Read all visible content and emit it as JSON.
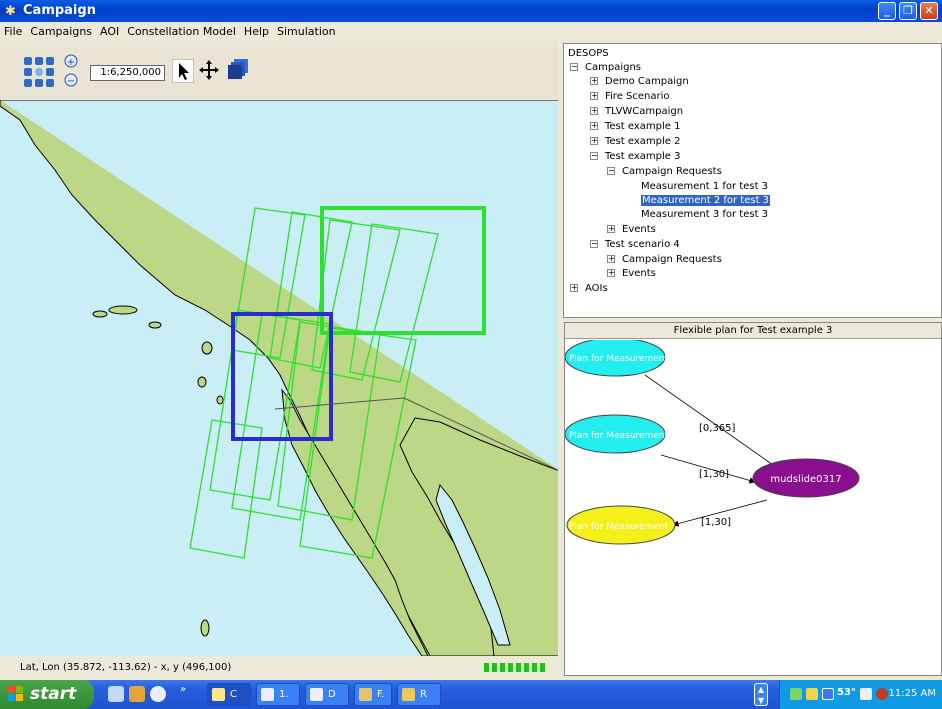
{
  "window": {
    "title": "Campaign"
  },
  "menu": [
    "File",
    "Campaigns",
    "AOI",
    "Constellation Model",
    "Help",
    "Simulation"
  ],
  "toolbar": {
    "scale": "1:6,250,000"
  },
  "status": {
    "coords": "Lat, Lon (35.872, -113.62) - x, y (496,100)"
  },
  "tree": {
    "root": "DESOPS",
    "campaigns": "Campaigns",
    "items": [
      "Demo Campaign",
      "Fire Scenario",
      "TLVWCampaign",
      "Test example 1",
      "Test example 2",
      "Test example 3"
    ],
    "campaign_requests": "Campaign Requests",
    "measurements": [
      "Measurement 1 for test 3",
      "Measurement 2 for test 3",
      "Measurement 3 for test 3"
    ],
    "events": "Events",
    "test_scenario_4": "Test scenario 4",
    "ts4_requests": "Campaign Requests",
    "ts4_events": "Events",
    "aois": "AOIs"
  },
  "graph": {
    "title": "Flexible plan for Test example 3",
    "node1": "Plan for Measurement",
    "node2": "Plan for Measurement",
    "node3": "Plan for Measurement",
    "center": "mudslide0317",
    "edge1": "[0,365]",
    "edge2": "[1,30]",
    "edge3": "[1,30]"
  },
  "taskbar": {
    "start": "start",
    "tasks": [
      "C",
      "1.",
      "D",
      "F.",
      "R"
    ],
    "clock": "11:25 AM",
    "tray_temp": "53°"
  },
  "colors": {
    "map_land": "#bcd886",
    "map_water": "#c9eef6",
    "footprint_green": "#2ee02e",
    "aoi_blue": "#2a2ad0",
    "node_cyan": "#22eef0",
    "node_yellow": "#f4f01a",
    "node_purple": "#8b0e8e"
  }
}
